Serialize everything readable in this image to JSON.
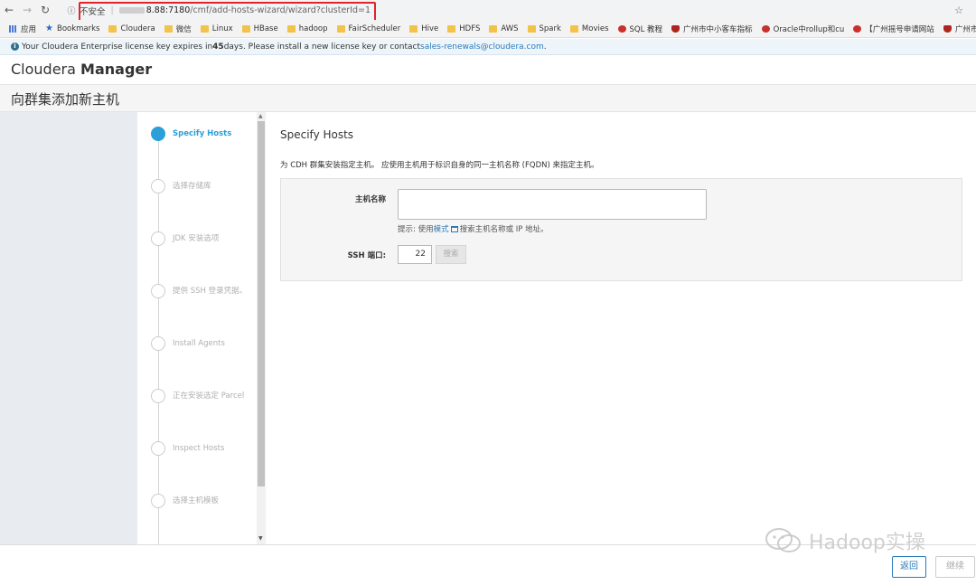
{
  "browser": {
    "insecure_label": "不安全",
    "url_host": "8.88:7180",
    "url_path": "/cmf/add-hosts-wizard/wizard?clusterId=1",
    "bookmarks": [
      {
        "label": "应用",
        "icon": "apps-icon"
      },
      {
        "label": "Bookmarks",
        "icon": "star-icon"
      },
      {
        "label": "Cloudera",
        "icon": "folder-icon"
      },
      {
        "label": "微信",
        "icon": "folder-icon"
      },
      {
        "label": "Linux",
        "icon": "folder-icon"
      },
      {
        "label": "HBase",
        "icon": "folder-icon"
      },
      {
        "label": "hadoop",
        "icon": "folder-icon"
      },
      {
        "label": "FairScheduler",
        "icon": "folder-icon"
      },
      {
        "label": "Hive",
        "icon": "folder-icon"
      },
      {
        "label": "HDFS",
        "icon": "folder-icon"
      },
      {
        "label": "AWS",
        "icon": "folder-icon"
      },
      {
        "label": "Spark",
        "icon": "folder-icon"
      },
      {
        "label": "Movies",
        "icon": "folder-icon"
      },
      {
        "label": "SQL 教程",
        "icon": "site-icon"
      },
      {
        "label": "广州市中小客车指标",
        "icon": "shield-icon"
      },
      {
        "label": "Oracle中rollup和cu",
        "icon": "site-icon"
      },
      {
        "label": "【广州摇号申请网站",
        "icon": "site-icon"
      },
      {
        "label": "广州市中小",
        "icon": "shield-icon"
      }
    ]
  },
  "license": {
    "prefix": "Your Cloudera Enterprise license key expires in ",
    "days": "45",
    "middle": " days. Please install a new license key or contact ",
    "email": "sales-renewals@cloudera.com",
    "suffix": "."
  },
  "brand": {
    "name": "Cloudera",
    "product": "Manager"
  },
  "page_title": "向群集添加新主机",
  "steps": [
    {
      "label": "Specify Hosts",
      "active": true
    },
    {
      "label": "选择存储库",
      "active": false
    },
    {
      "label": "JDK 安装选项",
      "active": false
    },
    {
      "label": "提供 SSH 登录凭据。",
      "active": false
    },
    {
      "label": "Install Agents",
      "active": false
    },
    {
      "label": "正在安装选定 Parcel",
      "active": false
    },
    {
      "label": "Inspect Hosts",
      "active": false
    },
    {
      "label": "选择主机模板",
      "active": false
    }
  ],
  "main": {
    "heading": "Specify Hosts",
    "description": "为 CDH 群集安装指定主机。 应使用主机用于标识自身的同一主机名称 (FQDN) 来指定主机。",
    "hostname_label": "主机名称",
    "hostname_value": "",
    "hint_prefix": "提示: 使用",
    "hint_link": "模式",
    "hint_suffix": "搜索主机名称或 IP 地址。",
    "ssh_port_label": "SSH 端口:",
    "ssh_port_value": "22",
    "search_button": "搜索"
  },
  "footer": {
    "back_button": "返回",
    "next_button": "继续"
  },
  "watermark": {
    "text": "Hadoop实操"
  },
  "colors": {
    "accent": "#2a9fd8",
    "link": "#2a7ab8",
    "highlight": "#e0242a"
  }
}
